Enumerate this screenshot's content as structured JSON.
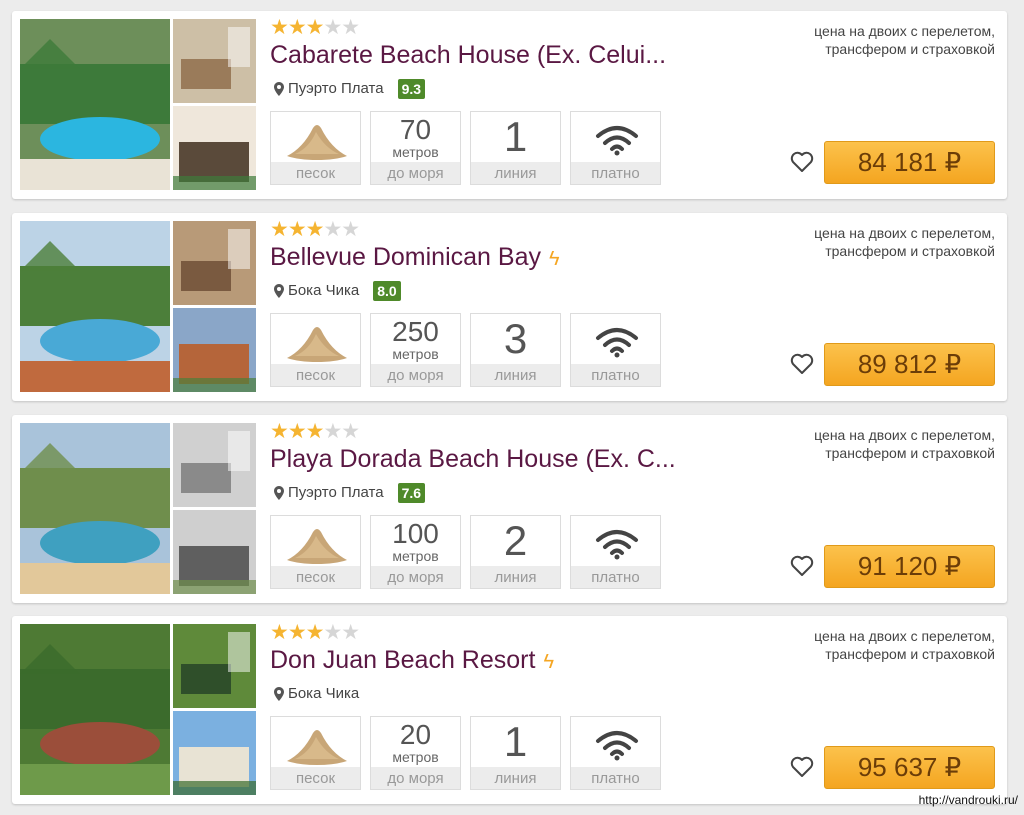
{
  "hotels": [
    {
      "stars_on": "★★★",
      "stars_off": "★★",
      "name": "Cabarete Beach House (Ex. Celui...",
      "has_bolt": false,
      "location": "Пуэрто Плата",
      "rating": "9.3",
      "sand_label": "песок",
      "distance_value": "70",
      "distance_unit": "метров",
      "distance_label": "до моря",
      "line_value": "1",
      "line_label": "линия",
      "wifi_label": "платно",
      "note_line1": "цена на двоих с перелетом,",
      "note_line2": "трансфером и страховкой",
      "price": "84 181 ₽"
    },
    {
      "stars_on": "★★★",
      "stars_off": "★★",
      "name": "Bellevue Dominican Bay",
      "has_bolt": true,
      "location": "Бока Чика",
      "rating": "8.0",
      "sand_label": "песок",
      "distance_value": "250",
      "distance_unit": "метров",
      "distance_label": "до моря",
      "line_value": "3",
      "line_label": "линия",
      "wifi_label": "платно",
      "note_line1": "цена на двоих с перелетом,",
      "note_line2": "трансфером и страховкой",
      "price": "89 812 ₽"
    },
    {
      "stars_on": "★★★",
      "stars_off": "★★",
      "name": "Playa Dorada Beach House (Ex. C...",
      "has_bolt": false,
      "location": "Пуэрто Плата",
      "rating": "7.6",
      "sand_label": "песок",
      "distance_value": "100",
      "distance_unit": "метров",
      "distance_label": "до моря",
      "line_value": "2",
      "line_label": "линия",
      "wifi_label": "платно",
      "note_line1": "цена на двоих с перелетом,",
      "note_line2": "трансфером и страховкой",
      "price": "91 120 ₽"
    },
    {
      "stars_on": "★★★",
      "stars_off": "★★",
      "name": "Don Juan Beach Resort",
      "has_bolt": true,
      "location": "Бока Чика",
      "rating": "",
      "sand_label": "песок",
      "distance_value": "20",
      "distance_unit": "метров",
      "distance_label": "до моря",
      "line_value": "1",
      "line_label": "линия",
      "wifi_label": "платно",
      "note_line1": "цена на двоих с перелетом,",
      "note_line2": "трансфером и страховкой",
      "price": "95 637 ₽"
    }
  ],
  "bolt_symbol": "ϟ",
  "footer": "http://vandrouki.ru/",
  "colors": {
    "title": "#5a1843",
    "star": "#f5b431",
    "rating_bg": "#4f8a2a",
    "price_bg": "#f4a520",
    "bolt": "#f5a623"
  },
  "icons": [
    "pin-icon",
    "sand-icon",
    "wifi-icon",
    "heart-icon",
    "bolt-icon"
  ]
}
